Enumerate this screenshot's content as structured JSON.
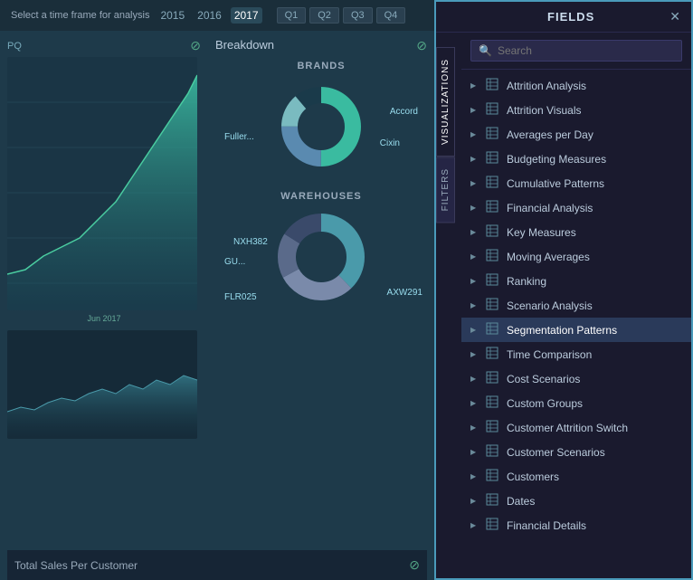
{
  "leftPanel": {
    "timeLabel": "Select a time frame for analysis",
    "years": [
      "2015",
      "2016",
      "2017"
    ],
    "activeYear": "2017",
    "quarters": [
      "Q1",
      "Q2",
      "Q3",
      "Q4"
    ],
    "chartTitle": "PQ",
    "breakdownTitle": "Breakdown",
    "brandsTitle": "BRANDS",
    "warehousesTitle": "WAREHOUSES",
    "brandLabels": {
      "accord": "Accord",
      "fuller": "Fuller...",
      "cixin": "Cixin"
    },
    "warehouseLabels": {
      "nxh": "NXH382",
      "gu": "GU...",
      "flr": "FLR025",
      "axw": "AXW291"
    },
    "chartDateLabel": "Jun 2017",
    "bottomTitle": "Total Sales Per Customer"
  },
  "rightPanel": {
    "title": "FIELDS",
    "tabs": [
      "VISUALIZATIONS",
      "FILTERS"
    ],
    "search": {
      "placeholder": "Search"
    },
    "fields": [
      {
        "name": "Attrition Analysis",
        "expanded": false
      },
      {
        "name": "Attrition Visuals",
        "expanded": false
      },
      {
        "name": "Averages per Day",
        "expanded": false
      },
      {
        "name": "Budgeting Measures",
        "expanded": false
      },
      {
        "name": "Cumulative Patterns",
        "expanded": false
      },
      {
        "name": "Financial Analysis",
        "expanded": false
      },
      {
        "name": "Key Measures",
        "expanded": false
      },
      {
        "name": "Moving Averages",
        "expanded": false
      },
      {
        "name": "Ranking",
        "expanded": false
      },
      {
        "name": "Scenario Analysis",
        "expanded": false
      },
      {
        "name": "Segmentation Patterns",
        "expanded": false,
        "highlighted": true
      },
      {
        "name": "Time Comparison",
        "expanded": false
      },
      {
        "name": "Cost Scenarios",
        "expanded": false
      },
      {
        "name": "Custom Groups",
        "expanded": false
      },
      {
        "name": "Customer Attrition Switch",
        "expanded": false
      },
      {
        "name": "Customer Scenarios",
        "expanded": false
      },
      {
        "name": "Customers",
        "expanded": false
      },
      {
        "name": "Dates",
        "expanded": false
      },
      {
        "name": "Financial Details",
        "expanded": false
      }
    ]
  }
}
